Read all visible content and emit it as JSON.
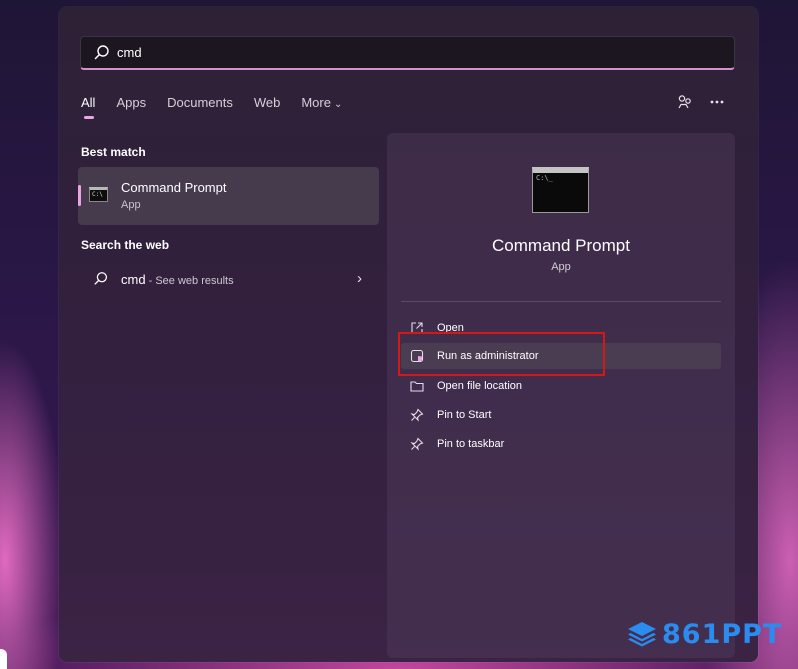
{
  "search": {
    "value": "cmd",
    "icon": "search-icon"
  },
  "tabs": [
    {
      "label": "All",
      "active": true
    },
    {
      "label": "Apps",
      "active": false
    },
    {
      "label": "Documents",
      "active": false
    },
    {
      "label": "Web",
      "active": false
    },
    {
      "label": "More",
      "active": false
    }
  ],
  "tab_more_chevron": "chevron-down-icon",
  "top_icons": [
    "share-nodes-icon",
    "more-options-icon"
  ],
  "best_match": {
    "section_title": "Best match",
    "item": {
      "name": "Command Prompt",
      "type": "App",
      "icon": "command-prompt-icon"
    }
  },
  "search_web": {
    "section_title": "Search the web",
    "item": {
      "query": "cmd",
      "suffix": " - See web results",
      "icon": "search-icon",
      "arrow": "chevron-right-icon"
    }
  },
  "detail": {
    "title": "Command Prompt",
    "type": "App",
    "actions": [
      {
        "label": "Open",
        "icon": "open-external-icon"
      },
      {
        "label": "Run as administrator",
        "icon": "admin-shield-icon",
        "highlighted": true
      },
      {
        "label": "Open file location",
        "icon": "folder-icon"
      },
      {
        "label": "Pin to Start",
        "icon": "pin-icon"
      },
      {
        "label": "Pin to taskbar",
        "icon": "pin-icon"
      }
    ]
  },
  "watermark": {
    "text": "861PPT",
    "icon": "layers-logo-icon"
  },
  "colors": {
    "accent": "#e8a7e3",
    "panel": "#33203f",
    "highlight_box": "#d31818",
    "watermark": "#2b8cf0"
  }
}
